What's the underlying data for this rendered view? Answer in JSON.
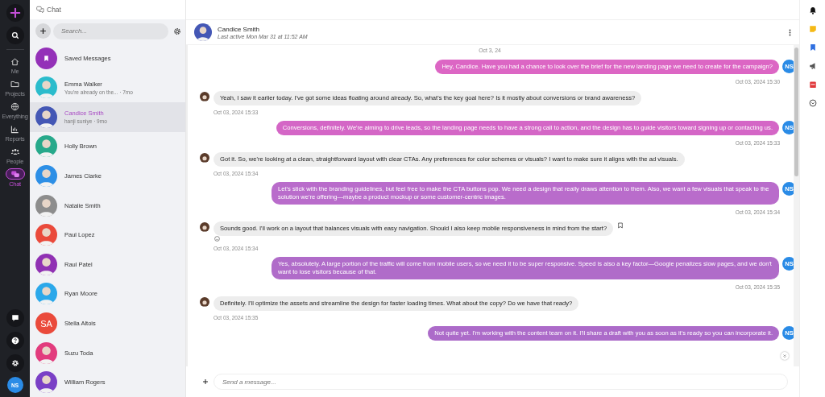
{
  "rail": {
    "items": [
      {
        "label": "Me",
        "selected": false
      },
      {
        "label": "Projects",
        "selected": false
      },
      {
        "label": "Everything",
        "selected": false
      },
      {
        "label": "Reports",
        "selected": false
      },
      {
        "label": "People",
        "selected": false
      },
      {
        "label": "Chat",
        "selected": true
      }
    ],
    "user_initials": "NS"
  },
  "top_bar": {
    "title": "Chat"
  },
  "chat_list": {
    "search": {
      "placeholder": "Search..."
    },
    "contacts": [
      {
        "name": "Saved Messages",
        "avatar": {
          "kind": "bookmark",
          "color": "#9431b8"
        },
        "selected": false
      },
      {
        "name": "Emma Walker",
        "subtitle": "You're already on the... · 7mo",
        "avatar": {
          "kind": "photo",
          "color": "#2bbccc"
        },
        "selected": false
      },
      {
        "name": "Candice Smith",
        "subtitle": "hanji suniye · 9mo",
        "avatar": {
          "kind": "photo",
          "color": "#4457b5"
        },
        "selected": true
      },
      {
        "name": "Holly Brown",
        "avatar": {
          "kind": "photo",
          "color": "#27a98b"
        },
        "selected": false
      },
      {
        "name": "James Clarke",
        "avatar": {
          "kind": "photo",
          "color": "#2d8fe6"
        },
        "selected": false
      },
      {
        "name": "Natalie Smith",
        "avatar": {
          "kind": "photo",
          "color": "#8d8d8d"
        },
        "selected": false
      },
      {
        "name": "Paul Lopez",
        "avatar": {
          "kind": "photo",
          "color": "#ea4a3b"
        },
        "selected": false
      },
      {
        "name": "Raul Patel",
        "avatar": {
          "kind": "photo",
          "color": "#9031b3"
        },
        "selected": false
      },
      {
        "name": "Ryan Moore",
        "avatar": {
          "kind": "photo",
          "color": "#2ba8ea"
        },
        "selected": false
      },
      {
        "name": "Stella Altois",
        "avatar": {
          "kind": "initials",
          "initials": "SA",
          "color": "#ea4a3b"
        },
        "selected": false
      },
      {
        "name": "Suzu Toda",
        "avatar": {
          "kind": "photo",
          "color": "#e23c7d"
        },
        "selected": false
      },
      {
        "name": "William Rogers",
        "avatar": {
          "kind": "photo",
          "color": "#7a40c6"
        },
        "selected": false
      }
    ]
  },
  "conversation": {
    "name": "Candice Smith",
    "status": "Last active Mon Mar 31 at 11:52 AM",
    "date_divider": "Oct 3, 24",
    "messages": [
      {
        "kind": "outgoing",
        "text": "Hey, Candice. Have you had a chance to look over the brief for the new landing page we need to create for the campaign?",
        "time": "Oct 03, 2024 15:30",
        "color": "#dc66c4",
        "initials": "NS"
      },
      {
        "kind": "incoming",
        "text": "Yeah, I saw it earlier today. I've got some ideas floating around already. So, what's the key goal here? Is it mostly about conversions or brand awareness?",
        "time": "Oct 03, 2024 15:33"
      },
      {
        "kind": "outgoing",
        "text": "Conversions, definitely. We're aiming to drive leads, so the landing page needs to have a strong call to action, and the design has to guide visitors toward signing up or contacting us.",
        "time": "Oct 03, 2024 15:33",
        "color": "#d466c6",
        "initials": "NS"
      },
      {
        "kind": "incoming",
        "text": "Got it. So, we're looking at a clean, straightforward layout with clear CTAs. Any preferences for color schemes or visuals? I want to make sure it aligns with the ad visuals.",
        "time": "Oct 03, 2024 15:34"
      },
      {
        "kind": "outgoing",
        "text": "Let's stick with the branding guidelines, but feel free to make the CTA buttons pop. We need a design that really draws attention to them. Also, we want a few visuals that speak to the solution we're offering—maybe a product mockup or some customer-centric images.",
        "time": "Oct 03, 2024 15:34",
        "color": "#b96ccb",
        "initials": "NS"
      },
      {
        "kind": "incoming",
        "text": "Sounds good. I'll work on a layout that balances visuals with easy navigation. Should I also keep mobile responsiveness in mind from the start?",
        "time": "Oct 03, 2024 15:34",
        "bookmark_action": true,
        "reaction_button": true
      },
      {
        "kind": "outgoing",
        "text": "Yes, absolutely. A large portion of the traffic will come from mobile users, so we need it to be super responsive. Speed is also a key factor—Google penalizes slow pages, and we don't want to lose visitors because of that.",
        "time": "Oct 03, 2024 15:35",
        "color": "#b06cc9",
        "initials": "NS"
      },
      {
        "kind": "incoming",
        "text": "Definitely. I'll optimize the assets and streamline the design for faster loading times. What about the copy? Do we have that ready?",
        "time": "Oct 03, 2024 15:35"
      },
      {
        "kind": "outgoing",
        "text": "Not quite yet. I'm working with the content team on it. I'll share a draft with you as soon as it's ready so you can incorporate it.",
        "color": "#ac6bc9",
        "initials": "NS"
      }
    ],
    "composer": {
      "placeholder": "Send a message..."
    }
  }
}
